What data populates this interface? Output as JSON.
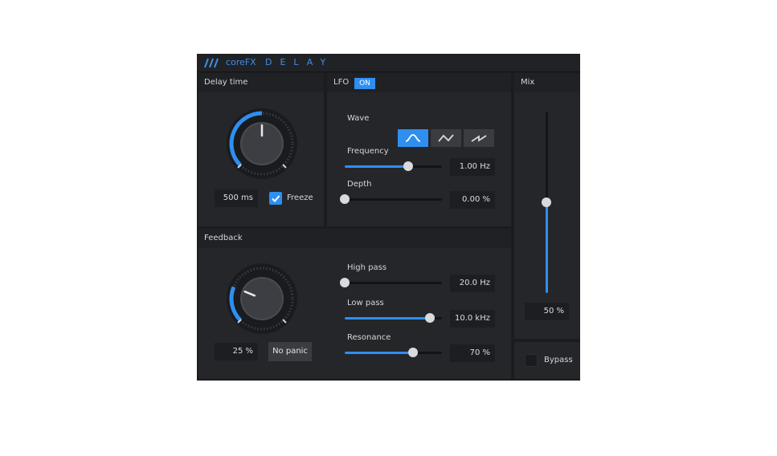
{
  "header": {
    "brand": "coreFX",
    "product": "DELAY"
  },
  "delay_time": {
    "title": "Delay time",
    "value": "500 ms",
    "freeze_label": "Freeze",
    "freeze_checked": true,
    "knob_fraction": 0.5
  },
  "lfo": {
    "title": "LFO",
    "on_label": "ON",
    "wave_label": "Wave",
    "waves": [
      "sine",
      "triangle",
      "saw"
    ],
    "active_wave": 0,
    "frequency": {
      "label": "Frequency",
      "value": "1.00 Hz",
      "fraction": 0.65
    },
    "depth": {
      "label": "Depth",
      "value": "0.00 %",
      "fraction": 0.0
    }
  },
  "feedback": {
    "title": "Feedback",
    "value": "25 %",
    "no_panic_label": "No panic",
    "knob_fraction": 0.25,
    "high_pass": {
      "label": "High pass",
      "value": "20.0 Hz",
      "fraction": 0.0
    },
    "low_pass": {
      "label": "Low pass",
      "value": "10.0 kHz",
      "fraction": 0.88
    },
    "resonance": {
      "label": "Resonance",
      "value": "70 %",
      "fraction": 0.7
    }
  },
  "mix": {
    "title": "Mix",
    "value": "50 %",
    "fraction": 0.5
  },
  "bypass": {
    "label": "Bypass",
    "checked": false
  },
  "colors": {
    "accent": "#2e8ff0",
    "panel": "#25262a",
    "background": "#1b1c1f"
  }
}
